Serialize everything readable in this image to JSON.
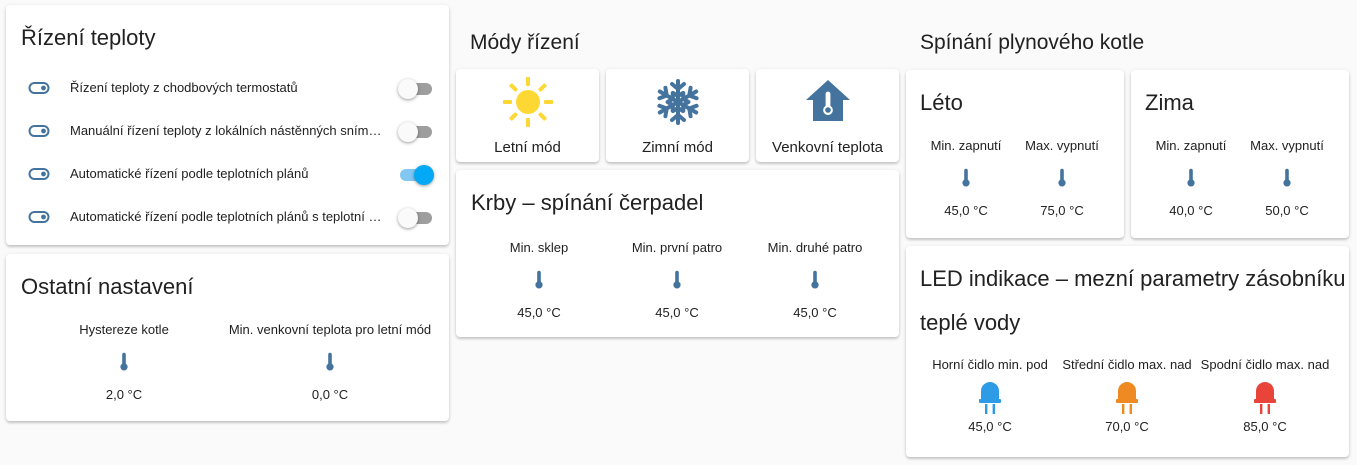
{
  "temp_control": {
    "title": "Řízení teploty",
    "rows": [
      {
        "label": "Řízení teploty z chodbových termostatů",
        "state": "off"
      },
      {
        "label": "Manuální řízení teploty z lokálních nástěnných snímčů ...",
        "state": "off"
      },
      {
        "label": "Automatické řízení podle teplotních plánů",
        "state": "on"
      },
      {
        "label": "Automatické řízení podle teplotních plánů s teplotní pr...",
        "state": "off"
      }
    ]
  },
  "other_settings": {
    "title": "Ostatní nastavení",
    "items": [
      {
        "name": "Hystereze kotle",
        "value": "2,0 °C",
        "icon": "thermometer-icon"
      },
      {
        "name": "Min. venkovní teplota pro letní mód",
        "value": "0,0 °C",
        "icon": "thermometer-icon"
      }
    ]
  },
  "modes": {
    "title": "Módy řízení",
    "buttons": [
      {
        "label": "Letní mód",
        "icon": "sun-icon",
        "color": "#fdd835"
      },
      {
        "label": "Zimní mód",
        "icon": "snowflake-icon",
        "color": "#44739e"
      },
      {
        "label": "Venkovní teplota",
        "icon": "home-thermometer-icon",
        "color": "#44739e"
      }
    ]
  },
  "fireplaces": {
    "title": "Krby – spínání čerpadel",
    "items": [
      {
        "name": "Min. sklep",
        "value": "45,0 °C",
        "icon": "thermometer-icon"
      },
      {
        "name": "Min. první patro",
        "value": "45,0 °C",
        "icon": "thermometer-icon"
      },
      {
        "name": "Min. druhé patro",
        "value": "45,0 °C",
        "icon": "thermometer-icon"
      }
    ]
  },
  "boiler": {
    "title": "Spínání plynového kotle",
    "summer": {
      "title": "Léto",
      "items": [
        {
          "name": "Min. zapnutí",
          "value": "45,0 °C",
          "icon": "thermometer-icon"
        },
        {
          "name": "Max. vypnutí",
          "value": "75,0 °C",
          "icon": "thermometer-icon"
        }
      ]
    },
    "winter": {
      "title": "Zima",
      "items": [
        {
          "name": "Min. zapnutí",
          "value": "40,0 °C",
          "icon": "thermometer-icon"
        },
        {
          "name": "Max. vypnutí",
          "value": "50,0 °C",
          "icon": "thermometer-icon"
        }
      ]
    }
  },
  "led": {
    "title_line1": "LED indikace – mezní parametry zásobníku",
    "title_line2": "teplé vody",
    "items": [
      {
        "name": "Horní čidlo min. pod",
        "value": "45,0 °C",
        "icon": "led-icon",
        "color": "#2e9be6"
      },
      {
        "name": "Střední čidlo max. nad",
        "value": "70,0 °C",
        "icon": "led-icon",
        "color": "#ef8a22"
      },
      {
        "name": "Spodní čidlo max. nad",
        "value": "85,0 °C",
        "icon": "led-icon",
        "color": "#e8443a"
      }
    ]
  },
  "colors": {
    "icon_blue": "#44739e",
    "switch_on": "#03a9f4"
  }
}
